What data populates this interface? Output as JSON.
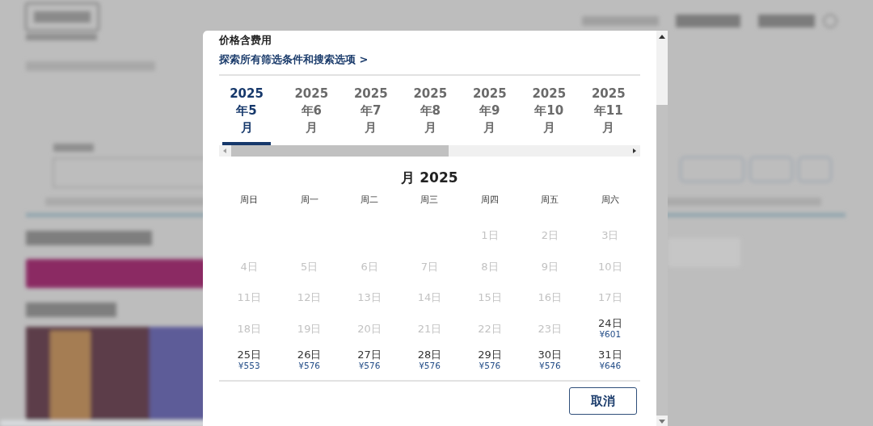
{
  "modal": {
    "fee_note": "价格含费用",
    "filters_link": "探索所有筛选条件和搜索选项 >",
    "month_tabs": [
      {
        "lines": [
          "2025",
          "年5",
          "月"
        ],
        "selected": true
      },
      {
        "lines": [
          "2025",
          "年6",
          "月"
        ],
        "selected": false
      },
      {
        "lines": [
          "2025",
          "年7",
          "月"
        ],
        "selected": false
      },
      {
        "lines": [
          "2025",
          "年8",
          "月"
        ],
        "selected": false
      },
      {
        "lines": [
          "2025",
          "年9",
          "月"
        ],
        "selected": false
      },
      {
        "lines": [
          "2025",
          "年10",
          "月"
        ],
        "selected": false
      },
      {
        "lines": [
          "2025",
          "年11",
          "月"
        ],
        "selected": false
      }
    ],
    "month_title": "月 2025",
    "weekdays": [
      "周日",
      "周一",
      "周二",
      "周三",
      "周四",
      "周五",
      "周六"
    ],
    "weeks": [
      [
        {
          "kind": "blank"
        },
        {
          "kind": "blank"
        },
        {
          "kind": "blank"
        },
        {
          "kind": "blank"
        },
        {
          "kind": "day",
          "day": "1日",
          "disabled": true
        },
        {
          "kind": "day",
          "day": "2日",
          "disabled": true
        },
        {
          "kind": "day",
          "day": "3日",
          "disabled": true
        }
      ],
      [
        {
          "kind": "day",
          "day": "4日",
          "disabled": true
        },
        {
          "kind": "day",
          "day": "5日",
          "disabled": true
        },
        {
          "kind": "day",
          "day": "6日",
          "disabled": true
        },
        {
          "kind": "day",
          "day": "7日",
          "disabled": true
        },
        {
          "kind": "day",
          "day": "8日",
          "disabled": true
        },
        {
          "kind": "day",
          "day": "9日",
          "disabled": true
        },
        {
          "kind": "day",
          "day": "10日",
          "disabled": true
        }
      ],
      [
        {
          "kind": "day",
          "day": "11日",
          "disabled": true
        },
        {
          "kind": "day",
          "day": "12日",
          "disabled": true
        },
        {
          "kind": "day",
          "day": "13日",
          "disabled": true
        },
        {
          "kind": "day",
          "day": "14日",
          "disabled": true
        },
        {
          "kind": "day",
          "day": "15日",
          "disabled": true
        },
        {
          "kind": "day",
          "day": "16日",
          "disabled": true
        },
        {
          "kind": "day",
          "day": "17日",
          "disabled": true
        }
      ],
      [
        {
          "kind": "day",
          "day": "18日",
          "disabled": true
        },
        {
          "kind": "day",
          "day": "19日",
          "disabled": true
        },
        {
          "kind": "day",
          "day": "20日",
          "disabled": true
        },
        {
          "kind": "day",
          "day": "21日",
          "disabled": true
        },
        {
          "kind": "day",
          "day": "22日",
          "disabled": true
        },
        {
          "kind": "day",
          "day": "23日",
          "disabled": true
        },
        {
          "kind": "day",
          "day": "24日",
          "disabled": false,
          "price": "¥601"
        }
      ],
      [
        {
          "kind": "day",
          "day": "25日",
          "disabled": false,
          "price": "¥553"
        },
        {
          "kind": "day",
          "day": "26日",
          "disabled": false,
          "price": "¥576"
        },
        {
          "kind": "day",
          "day": "27日",
          "disabled": false,
          "price": "¥576"
        },
        {
          "kind": "day",
          "day": "28日",
          "disabled": false,
          "price": "¥576"
        },
        {
          "kind": "day",
          "day": "29日",
          "disabled": false,
          "price": "¥576"
        },
        {
          "kind": "day",
          "day": "30日",
          "disabled": false,
          "price": "¥576"
        },
        {
          "kind": "day",
          "day": "31日",
          "disabled": false,
          "price": "¥646"
        }
      ]
    ],
    "cancel_button": "取消"
  }
}
